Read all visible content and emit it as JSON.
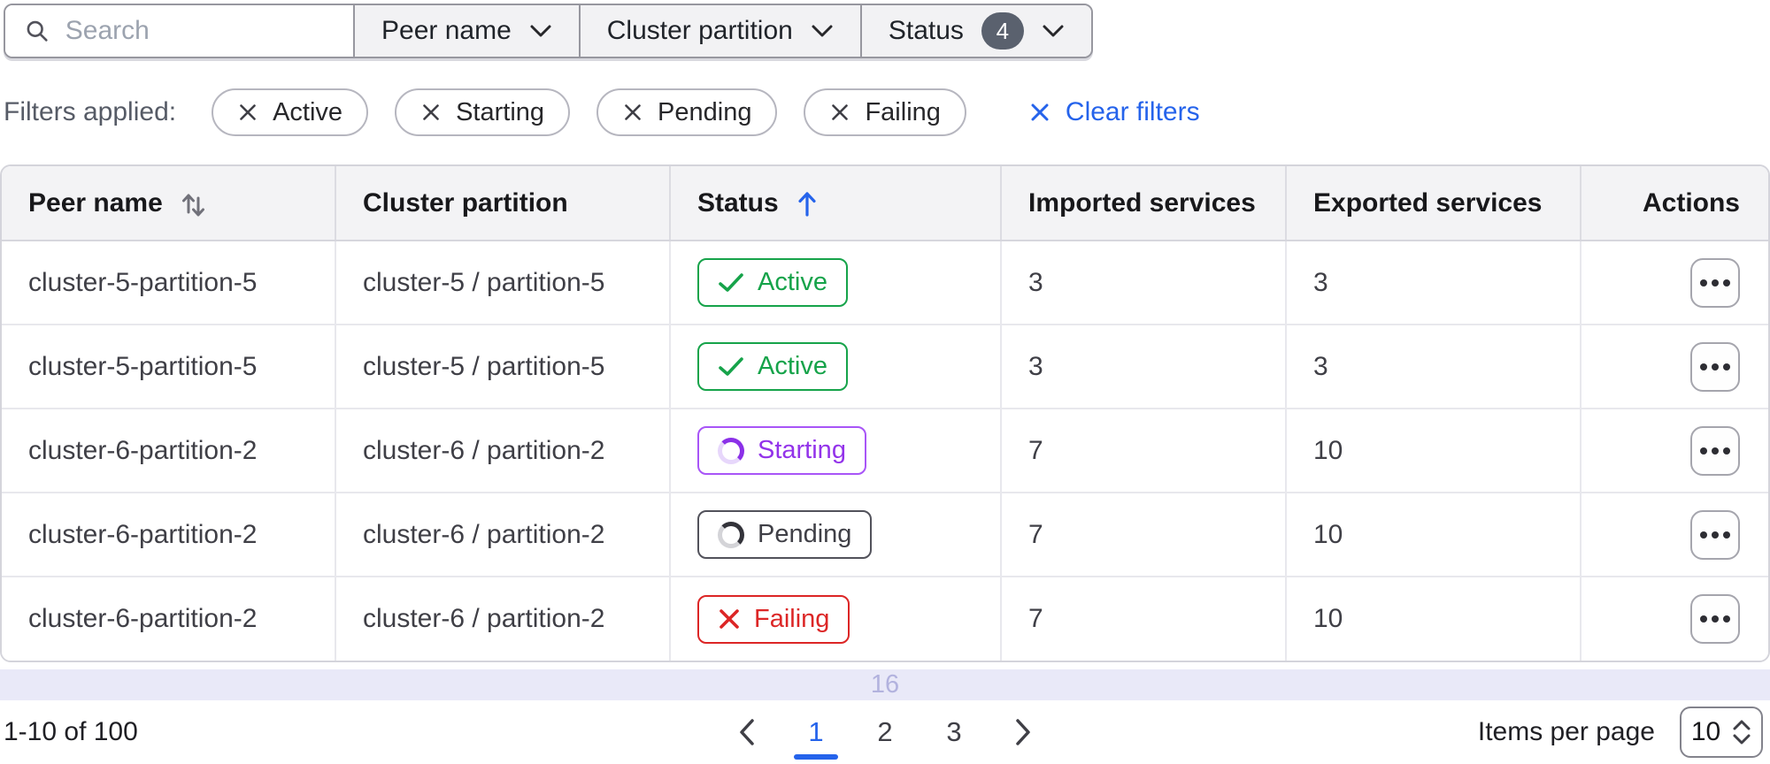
{
  "toolbar": {
    "search": {
      "placeholder": "Search",
      "value": ""
    },
    "dropdowns": [
      {
        "label": "Peer name"
      },
      {
        "label": "Cluster partition"
      },
      {
        "label": "Status",
        "badge": "4"
      }
    ]
  },
  "filters": {
    "label": "Filters applied:",
    "chips": [
      "Active",
      "Starting",
      "Pending",
      "Failing"
    ],
    "clear_label": "Clear filters"
  },
  "table": {
    "columns": [
      {
        "label": "Peer name",
        "sortable": true,
        "sort": "none"
      },
      {
        "label": "Cluster partition"
      },
      {
        "label": "Status",
        "sortable": true,
        "sort": "ascending"
      },
      {
        "label": "Imported services"
      },
      {
        "label": "Exported services"
      },
      {
        "label": "Actions"
      }
    ],
    "rows": [
      {
        "peer_name": "cluster-5-partition-5",
        "cluster_partition": "cluster-5 / partition-5",
        "status": "Active",
        "status_variant": "active",
        "imported_services": "3",
        "exported_services": "3"
      },
      {
        "peer_name": "cluster-5-partition-5",
        "cluster_partition": "cluster-5 / partition-5",
        "status": "Active",
        "status_variant": "active",
        "imported_services": "3",
        "exported_services": "3"
      },
      {
        "peer_name": "cluster-6-partition-2",
        "cluster_partition": "cluster-6 / partition-2",
        "status": "Starting",
        "status_variant": "starting",
        "imported_services": "7",
        "exported_services": "10"
      },
      {
        "peer_name": "cluster-6-partition-2",
        "cluster_partition": "cluster-6 / partition-2",
        "status": "Pending",
        "status_variant": "pending",
        "imported_services": "7",
        "exported_services": "10"
      },
      {
        "peer_name": "cluster-6-partition-2",
        "cluster_partition": "cluster-6 / partition-2",
        "status": "Failing",
        "status_variant": "failing",
        "imported_services": "7",
        "exported_services": "10"
      }
    ],
    "overflow_row_text": "16"
  },
  "pagination": {
    "range_label": "1-10 of 100",
    "pages": [
      "1",
      "2",
      "3"
    ],
    "active_page": "1",
    "items_per_page_label": "Items per page",
    "items_per_page_value": "10"
  },
  "colors": {
    "link_blue": "#2563eb",
    "status_active_green": "#16a34a",
    "status_starting_purple": "#9333ea",
    "status_pending_gray": "#3f3f46",
    "status_failing_red": "#dc2626",
    "filter_count_pill_gray": "#5a616e",
    "overflow_row_lavender": "#e9e9f8"
  }
}
